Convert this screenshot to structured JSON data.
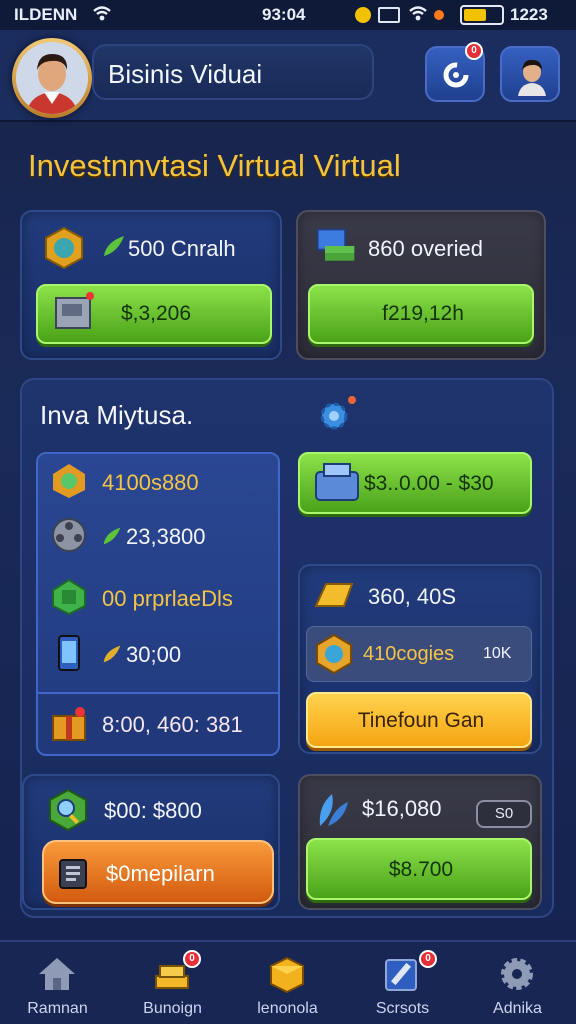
{
  "status_bar": {
    "carrier": "ILDENN",
    "time": "93:04",
    "battery_text": "1223"
  },
  "header": {
    "title": "Bisinis Viduai",
    "notification_badge": "0"
  },
  "section": {
    "title": "Investnnvtasi Virtual Virtual"
  },
  "cards_top": [
    {
      "label": "500 Cnralh",
      "button": "$,3,206"
    },
    {
      "label": "860 overied",
      "button": "f219,12h"
    }
  ],
  "panel": {
    "title": "Inva Miytusa.",
    "rows": [
      {
        "text": "4100s880",
        "icon": "coin-gem-icon"
      },
      {
        "text": "23,3800",
        "icon": "film-reel-icon"
      },
      {
        "text": "00 prprlaeDls",
        "icon": "green-gem-icon"
      },
      {
        "text": "30;00",
        "icon": "phone-icon"
      },
      {
        "text": "8:00, 460: 381",
        "icon": "gift-box-icon"
      }
    ],
    "green_button": "$3..0.00 - $30",
    "right_card": {
      "value": "360, 40S",
      "sub_label": "410cogies",
      "sub_tag": "10K",
      "yellow_button": "Tinefoun Gan"
    },
    "bottom_left": {
      "value": "$00: $800",
      "orange_button": "$0mepilarn"
    },
    "bottom_right": {
      "value": "$16,080",
      "tag": "S0",
      "green_button": "$8.700"
    }
  },
  "nav": [
    {
      "label": "Ramnan",
      "icon": "home-icon"
    },
    {
      "label": "Bunoign",
      "icon": "gold-bars-icon",
      "badge": "0"
    },
    {
      "label": "lenonola",
      "icon": "box-icon"
    },
    {
      "label": "Scrsots",
      "icon": "edit-icon",
      "badge": "0"
    },
    {
      "label": "Adnika",
      "icon": "gear-icon"
    }
  ],
  "colors": {
    "accent_gold": "#f5c33a",
    "green_button": "#5fbf26",
    "orange_button": "#e56c1a",
    "yellow_button": "#ffc12b",
    "background": "#1a2a58"
  }
}
